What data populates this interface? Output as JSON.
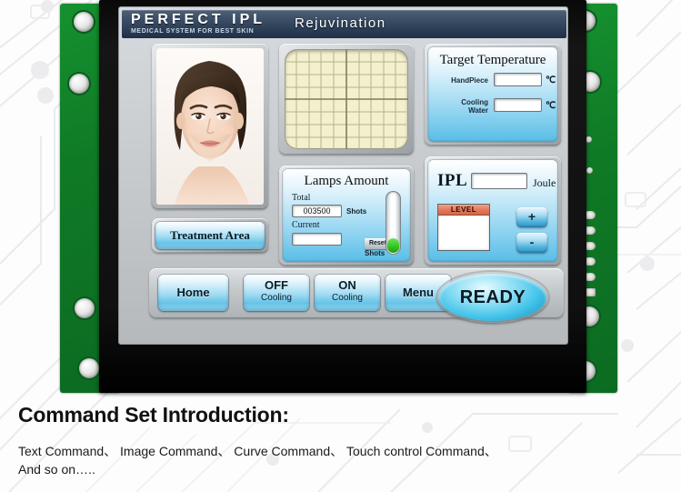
{
  "device": {
    "screen": {
      "titlebar": {
        "brand_main": "PERFECT IPL",
        "brand_sub": "MEDICAL SYSTEM FOR BEST SKIN",
        "screen_title": "Rejuvination"
      },
      "target_temperature": {
        "title": "Target Temperature",
        "handpiece_label": "HandPiece",
        "handpiece_value": "",
        "handpiece_unit": "℃",
        "cooling_label_line1": "Cooling",
        "cooling_label_line2": "Water",
        "cooling_value": "",
        "cooling_unit": "℃"
      },
      "lamps_amount": {
        "title": "Lamps Amount",
        "total_label": "Total",
        "total_value": "003500",
        "total_unit": "Shots",
        "current_label": "Current",
        "current_value": "",
        "current_unit": "Shots",
        "reset_label": "Reset",
        "gauge_percent": 22
      },
      "ipl": {
        "label": "IPL",
        "value": "",
        "unit": "Joule",
        "level_header": "LEVEL",
        "level_value": "",
        "plus_label": "+",
        "minus_label": "-"
      },
      "treatment_area_label": "Treatment Area",
      "nav_buttons": [
        {
          "name": "home",
          "line1": "Home",
          "line2": ""
        },
        {
          "name": "cooling-off",
          "line1": "OFF",
          "line2": "Cooling"
        },
        {
          "name": "cooling-on",
          "line1": "ON",
          "line2": "Cooling"
        },
        {
          "name": "menu",
          "line1": "Menu",
          "line2": ""
        }
      ],
      "ready_label": "READY"
    }
  },
  "caption": {
    "heading": "Command Set Introduction:",
    "line1": "Text Command、 Image Command、 Curve Command、 Touch control Command、",
    "line2": "And so on….."
  },
  "colors": {
    "pcb_green": "#0f7a26",
    "titlebar_blue": "#2d4058",
    "panel_cyan": "#8fd3f0",
    "ready_cyan": "#45c4ea",
    "level_orange": "#e2775a",
    "gauge_green": "#31c41f",
    "grid_cream": "#f2f0cd"
  }
}
